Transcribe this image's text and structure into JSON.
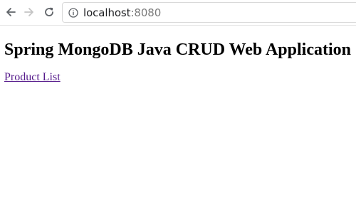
{
  "browser": {
    "url_host": "localhost",
    "url_port": ":8080",
    "icons": {
      "back": "arrow-left-icon",
      "forward": "arrow-right-icon",
      "reload": "reload-icon",
      "site_info": "info-icon"
    }
  },
  "page": {
    "heading": "Spring MongoDB Java CRUD Web Application",
    "link_label": "Product List",
    "link_color": "#551a8b"
  }
}
